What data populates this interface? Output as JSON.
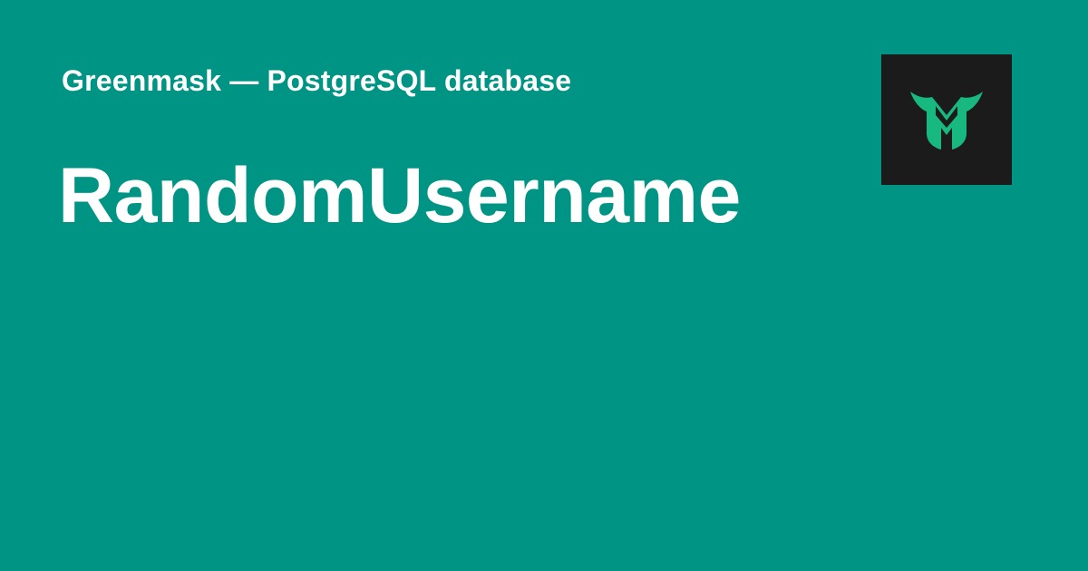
{
  "header": {
    "site_name": "Greenmask — PostgreSQL database"
  },
  "main": {
    "title": "RandomUsername"
  },
  "logo": {
    "icon": "greenmask-logo-icon"
  },
  "colors": {
    "background": "#009485",
    "logo_background": "#1b1b1b",
    "logo_green": "#17b980",
    "text": "#ffffff"
  }
}
